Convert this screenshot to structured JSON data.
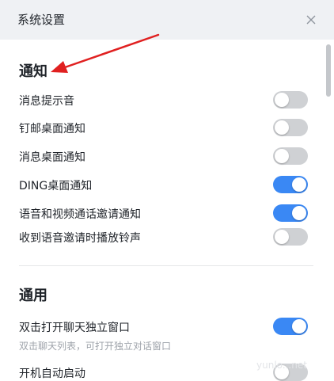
{
  "window": {
    "title": "系统设置"
  },
  "sections": {
    "notify": {
      "title": "通知",
      "items": [
        {
          "label": "消息提示音",
          "on": false
        },
        {
          "label": "钉邮桌面通知",
          "on": false
        },
        {
          "label": "消息桌面通知",
          "on": false
        },
        {
          "label": "DING桌面通知",
          "on": true
        },
        {
          "label": "语音和视频通话邀请通知",
          "on": true
        },
        {
          "label": "收到语音邀请时播放铃声",
          "on": false
        }
      ]
    },
    "general": {
      "title": "通用",
      "items": [
        {
          "label": "双击打开聊天独立窗口",
          "on": true,
          "description": "双击聊天列表，可打开独立对话窗口"
        },
        {
          "label": "开机自动启动",
          "on": false
        }
      ]
    }
  },
  "watermark": "yunlo...net",
  "colors": {
    "toggle_on": "#3a88f4",
    "toggle_off": "#cfd1d4",
    "arrow": "#e02020"
  }
}
